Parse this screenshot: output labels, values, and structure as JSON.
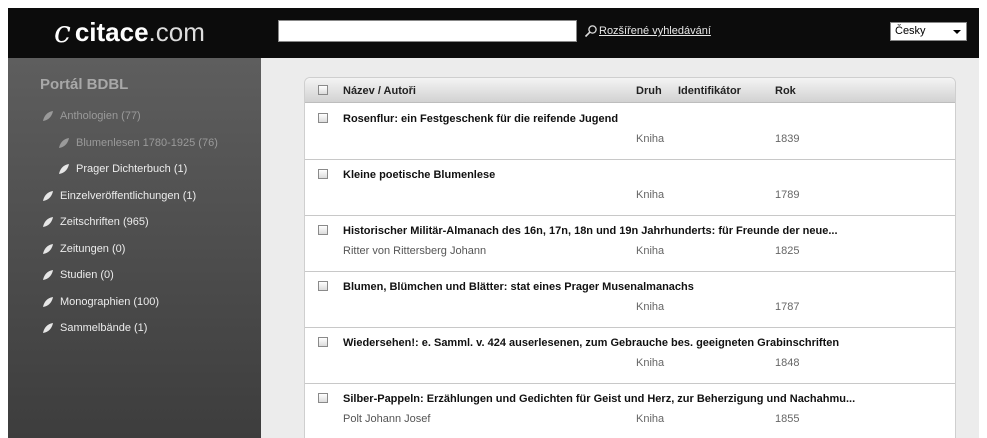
{
  "header": {
    "logo_glyph": "c",
    "logo_name": "citace",
    "logo_tld": ".com",
    "search_value": "",
    "search_placeholder": "",
    "advanced_search_label": "Rozšířené vyhledávání",
    "language": "Česky"
  },
  "sidebar": {
    "title": "Portál BDBL",
    "items": [
      {
        "label": "Anthologien (77)",
        "level": 0,
        "muted": true
      },
      {
        "label": "Blumenlesen 1780-1925 (76)",
        "level": 1,
        "muted": true
      },
      {
        "label": "Prager Dichterbuch (1)",
        "level": 1,
        "muted": false
      },
      {
        "label": "Einzelveröffentlichungen (1)",
        "level": 0,
        "muted": false
      },
      {
        "label": "Zeitschriften (965)",
        "level": 0,
        "muted": false
      },
      {
        "label": "Zeitungen (0)",
        "level": 0,
        "muted": false
      },
      {
        "label": "Studien (0)",
        "level": 0,
        "muted": false
      },
      {
        "label": "Monographien (100)",
        "level": 0,
        "muted": false
      },
      {
        "label": "Sammelbände (1)",
        "level": 0,
        "muted": false
      }
    ]
  },
  "results": {
    "columns": {
      "title": "Název / Autoři",
      "type": "Druh",
      "identifier": "Identifikátor",
      "year": "Rok"
    },
    "rows": [
      {
        "title": "Rosenflur: ein Festgeschenk für die reifende Jugend",
        "author": "",
        "type": "Kniha",
        "identifier": "",
        "year": "1839"
      },
      {
        "title": "Kleine poetische Blumenlese",
        "author": "",
        "type": "Kniha",
        "identifier": "",
        "year": "1789"
      },
      {
        "title": "Historischer Militär-Almanach des 16n, 17n, 18n und 19n Jahrhunderts: für Freunde der neue...",
        "author": "Ritter von Rittersberg Johann",
        "type": "Kniha",
        "identifier": "",
        "year": "1825"
      },
      {
        "title": "Blumen, Blümchen und Blätter: stat eines Prager Musenalmanachs",
        "author": "",
        "type": "Kniha",
        "identifier": "",
        "year": "1787"
      },
      {
        "title": "Wiedersehen!: e. Samml. v. 424 auserlesenen, zum Gebrauche bes. geeigneten Grabinschriften",
        "author": "",
        "type": "Kniha",
        "identifier": "",
        "year": "1848"
      },
      {
        "title": "Silber-Pappeln: Erzählungen und Gedichten für Geist und Herz, zur Beherzigung und Nachahmu...",
        "author": "Polt Johann Josef",
        "type": "Kniha",
        "identifier": "",
        "year": "1855"
      }
    ]
  }
}
